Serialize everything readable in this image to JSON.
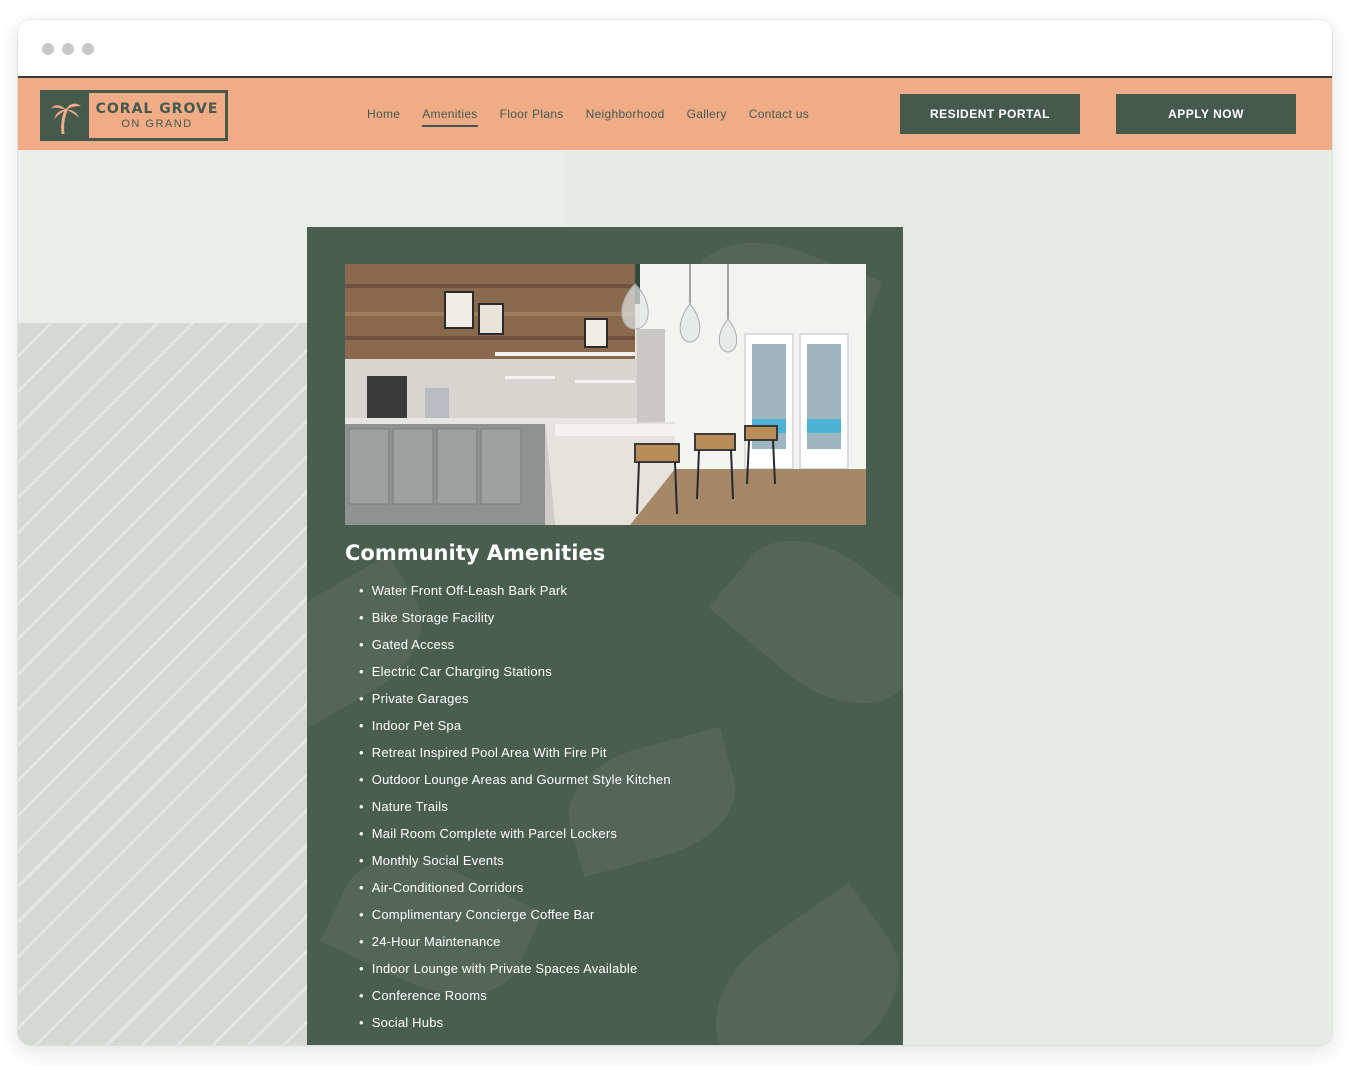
{
  "brand": {
    "name": "CORAL GROVE",
    "sub": "ON GRAND",
    "icon": "palm-tree-icon"
  },
  "nav": {
    "items": [
      {
        "label": "Home"
      },
      {
        "label": "Amenities",
        "active": true
      },
      {
        "label": "Floor Plans"
      },
      {
        "label": "Neighborhood"
      },
      {
        "label": "Gallery"
      },
      {
        "label": "Contact us"
      }
    ]
  },
  "buttons": {
    "resident_portal": "RESIDENT PORTAL",
    "apply_now": "APPLY NOW"
  },
  "section": {
    "title": "Community Amenities",
    "image_alt": "clubhouse kitchen lounge photo",
    "amenities": [
      "Water Front Off-Leash Bark Park",
      "Bike Storage Facility",
      "Gated Access",
      "Electric Car Charging Stations",
      "Private Garages",
      "Indoor Pet Spa",
      "Retreat Inspired Pool Area With Fire Pit",
      "Outdoor Lounge Areas and Gourmet Style Kitchen",
      "Nature Trails",
      "Mail Room Complete with Parcel Lockers",
      "Monthly Social Events",
      "Air-Conditioned Corridors",
      "Complimentary Concierge Coffee Bar",
      "24-Hour Maintenance",
      "Indoor Lounge with Private Spaces Available",
      "Conference Rooms",
      "Social Hubs"
    ]
  },
  "colors": {
    "header": "#f0ab87",
    "primary": "#455a4d",
    "card": "#4a5e50",
    "page_bg": "#e7ebe6"
  }
}
